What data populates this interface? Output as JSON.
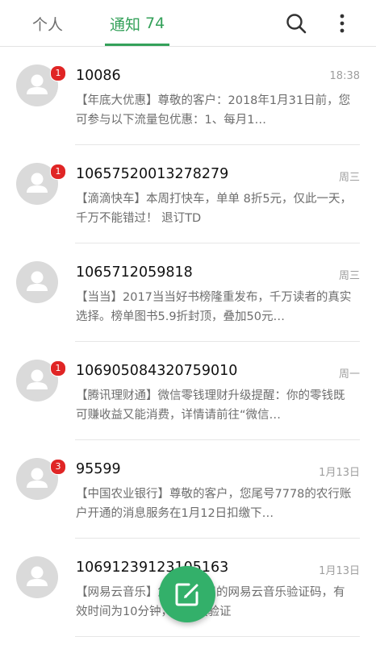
{
  "header": {
    "tab_personal": "个人",
    "tab_notice": "通知",
    "tab_notice_count": "74",
    "search_icon": "search-icon",
    "more_icon": "more-vertical-icon",
    "accent_color": "#34a15a"
  },
  "messages": [
    {
      "sender": "10086",
      "time": "18:38",
      "badge": "1",
      "preview": "【年底大优惠】尊敬的客户：2018年1月31日前，您可参与以下流量包优惠：1、每月1…"
    },
    {
      "sender": "10657520013278279",
      "time": "周三",
      "badge": "1",
      "preview": "【滴滴快车】本周打快车，单单 8折5元，仅此一天，千万不能错过！ 退订TD"
    },
    {
      "sender": "1065712059818",
      "time": "周三",
      "badge": "",
      "preview": "【当当】2017当当好书榜隆重发布，千万读者的真实选择。榜单图书5.9折封顶，叠加50元…"
    },
    {
      "sender": "106905084320759010",
      "time": "周一",
      "badge": "1",
      "preview": "【腾讯理财通】微信零钱理财升级提醒：你的零钱既可赚收益又能消费，详情请前往“微信…"
    },
    {
      "sender": "95599",
      "time": "1月13日",
      "badge": "3",
      "preview": "【中国农业银行】尊敬的客户，您尾号7778的农行账户开通的消息服务在1月12日扣缴下…"
    },
    {
      "sender": "10691239123105163",
      "time": "1月13日",
      "badge": "",
      "preview": "【网易云音乐】您正在使用的网易云音乐验证码，有效时间为10分钟，请尽快验证"
    }
  ],
  "fab": {
    "icon": "compose-icon",
    "color": "#33b06a"
  },
  "badge_color": "#e02525"
}
